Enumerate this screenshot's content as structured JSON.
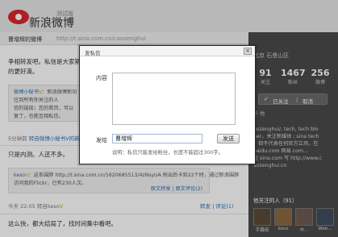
{
  "brand": {
    "beta": "测试版",
    "name": "新浪微博"
  },
  "header": {
    "owner": "曹增辉的微博",
    "url": "http://t.sina.com.cn/caozenghui"
  },
  "feed": {
    "post1_line1": "争相转发吧。私信是大家期待",
    "post1_line2": "的更好滴。",
    "quote1": {
      "line1_prefix": "微博小秘书",
      "line1_v": "V",
      "line1_rest": "：新浪微博新功",
      "line2": "往到所有你关注的人",
      "line3": "信的链接；您的首页，可以",
      "line4": "复了，也能互相私信。"
    },
    "post1_meta_prefix": "5分钟前",
    "post1_meta_forward": "转自微博小秘书V的新",
    "post2": "只是内测。人还不多。",
    "quote2": {
      "line1_user": "keso",
      "line1_v": "V",
      "line1_rest": "：这条围脖 http://t.sina.com.cn/1620685513/4zNsyUA 拖出后卡到22个时，通过新浪围脖",
      "line2": "访问我的Flickr，已有230人次。",
      "tools": "原文转发 | 原文评论(2)"
    },
    "post2_meta": "今天 22:05  转自keso",
    "post2_meta_link": "V",
    "post2_tools": "转发 | 评论(1)",
    "post3": "这么快，都大结局了，找时间集中看吧。"
  },
  "sidebar": {
    "location": "北京 石景山区",
    "stats": [
      {
        "num": "91",
        "label": "关注"
      },
      {
        "num": "1467",
        "label": "粉丝"
      },
      {
        "num": "256",
        "label": "微博"
      }
    ],
    "follow": {
      "check": "✓",
      "text": "已关注",
      "sep": "|",
      "cancel": "取消"
    },
    "who": "千 他",
    "bio": "aozenghui/, tech, tech blo\nger，关注新媒体 ; sina tech\n，但不代表任何官方立场，在\nbaidu.com 网易.com...\n在 sina.com 写 http://www.c\naozenghui.cn",
    "group": "他关注的人（91）",
    "thumbs": [
      {
        "label": "字幕组",
        "color": "#5a4a3a"
      },
      {
        "label": "keso",
        "color": "#8a6a40"
      },
      {
        "label": "中...",
        "color": "#6f5a52"
      },
      {
        "label": "Web...",
        "color": "#3f4e5e"
      }
    ]
  },
  "modal": {
    "title": "发私信",
    "close": "×",
    "content_label": "内容",
    "content_value": "",
    "to_label": "发给",
    "recipient": "曹增辉",
    "send": "发送",
    "note": "说明：私信只能发给粉丝，长度不能超过300字。"
  },
  "colors": {
    "accent": "#2a6fb6",
    "brand_red": "#d7282f",
    "sidebar_bg": "#4a4a4a"
  }
}
